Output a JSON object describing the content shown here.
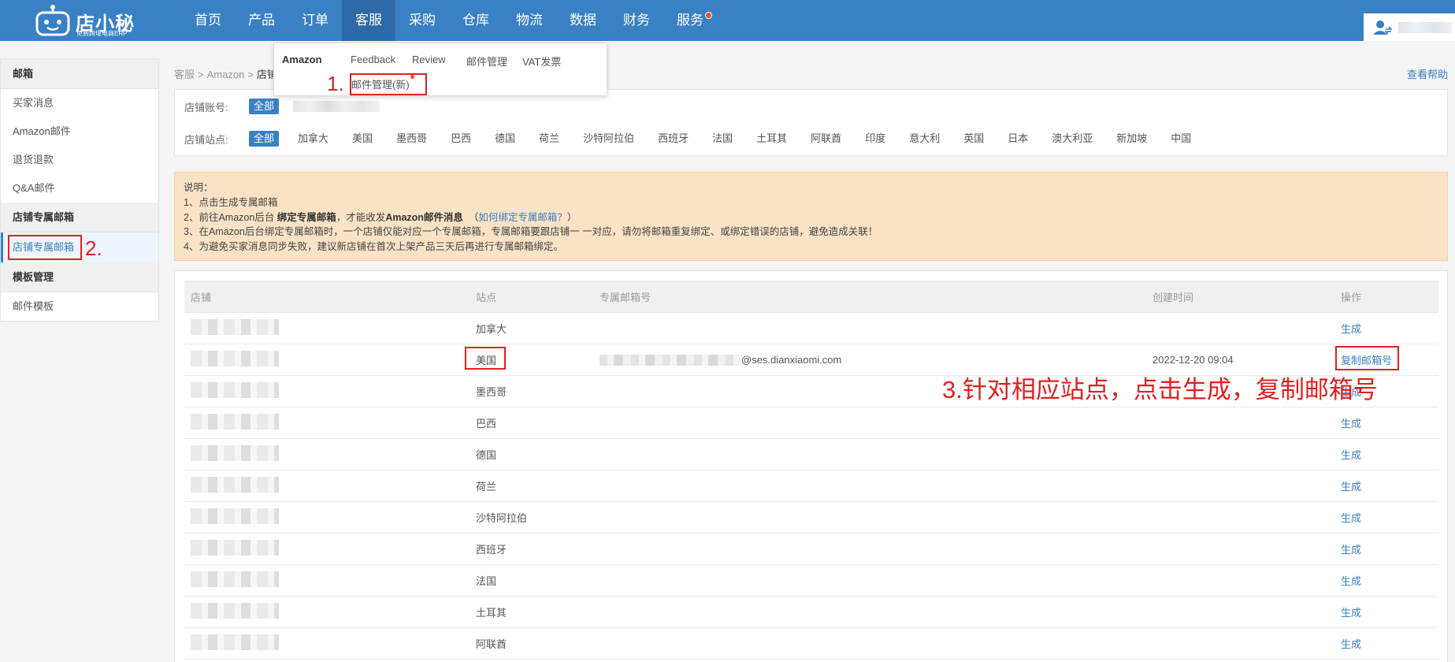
{
  "app": {
    "logo_name": "店小秘",
    "logo_sub": "免费跨境电商ERP"
  },
  "nav": {
    "items": [
      {
        "label": "首页"
      },
      {
        "label": "产品"
      },
      {
        "label": "订单"
      },
      {
        "label": "客服"
      },
      {
        "label": "采购"
      },
      {
        "label": "仓库"
      },
      {
        "label": "物流"
      },
      {
        "label": "数据"
      },
      {
        "label": "财务"
      },
      {
        "label": "服务"
      }
    ],
    "active_index": 3
  },
  "dropdown": {
    "title": "Amazon",
    "items": [
      "Feedback",
      "Review",
      "邮件管理",
      "VAT发票"
    ],
    "new_item": "邮件管理(新)"
  },
  "sidebar": {
    "groups": [
      {
        "title": "邮箱",
        "items": [
          "买家消息",
          "Amazon邮件",
          "退货退款",
          "Q&A邮件"
        ]
      },
      {
        "title": "店铺专属邮箱",
        "items": [
          "店铺专属邮箱"
        ]
      },
      {
        "title": "模板管理",
        "items": [
          "邮件模板"
        ]
      }
    ]
  },
  "breadcrumb": [
    "客服",
    "Amazon",
    "店铺"
  ],
  "help_link": "查看帮助",
  "filter": {
    "account_label": "店铺账号:",
    "account_all": "全部",
    "site_label": "店铺站点:",
    "site_all": "全部",
    "sites": [
      "加拿大",
      "美国",
      "墨西哥",
      "巴西",
      "德国",
      "荷兰",
      "沙特阿拉伯",
      "西班牙",
      "法国",
      "土耳其",
      "阿联酋",
      "印度",
      "意大利",
      "英国",
      "日本",
      "澳大利亚",
      "新加坡",
      "中国"
    ]
  },
  "notice": {
    "title": "说明：",
    "line1": "1、点击生成专属邮箱",
    "line2_a": "2、前往Amazon后台 ",
    "line2_b": "绑定专属邮箱",
    "line2_c": "，才能收发",
    "line2_d": "Amazon邮件消息",
    "line2_e": "  （",
    "line2_link": "如何绑定专属邮箱？",
    "line2_f": "）",
    "line3": "3、在Amazon后台绑定专属邮箱时，一个店铺仅能对应一个专属邮箱，专属邮箱要跟店铺一 一对应，请勿将邮箱重复绑定、或绑定错误的店铺，避免造成关联！",
    "line4": "4、为避免买家消息同步失败，建议新店铺在首次上架产品三天后再进行专属邮箱绑定。"
  },
  "table": {
    "headers": {
      "shop": "店铺",
      "site": "站点",
      "mail": "专属邮箱号",
      "time": "创建时间",
      "op": "操作"
    },
    "rows": [
      {
        "site": "加拿大",
        "mail_suffix": "",
        "time": "",
        "op": "生成"
      },
      {
        "site": "美国",
        "mail_suffix": "@ses.dianxiaomi.com",
        "time": "2022-12-20 09:04",
        "op": "复制邮箱号"
      },
      {
        "site": "墨西哥",
        "mail_suffix": "",
        "time": "",
        "op": "生成"
      },
      {
        "site": "巴西",
        "mail_suffix": "",
        "time": "",
        "op": "生成"
      },
      {
        "site": "德国",
        "mail_suffix": "",
        "time": "",
        "op": "生成"
      },
      {
        "site": "荷兰",
        "mail_suffix": "",
        "time": "",
        "op": "生成"
      },
      {
        "site": "沙特阿拉伯",
        "mail_suffix": "",
        "time": "",
        "op": "生成"
      },
      {
        "site": "西班牙",
        "mail_suffix": "",
        "time": "",
        "op": "生成"
      },
      {
        "site": "法国",
        "mail_suffix": "",
        "time": "",
        "op": "生成"
      },
      {
        "site": "土耳其",
        "mail_suffix": "",
        "time": "",
        "op": "生成"
      },
      {
        "site": "阿联酋",
        "mail_suffix": "",
        "time": "",
        "op": "生成"
      }
    ]
  },
  "annotations": {
    "step1": "1.",
    "step2": "2.",
    "step3": "3.针对相应站点，点击生成，复制邮箱号"
  },
  "colors": {
    "accent": "#3a80c4",
    "annotation_red": "#e02020",
    "notice_bg": "#fae2c5"
  }
}
